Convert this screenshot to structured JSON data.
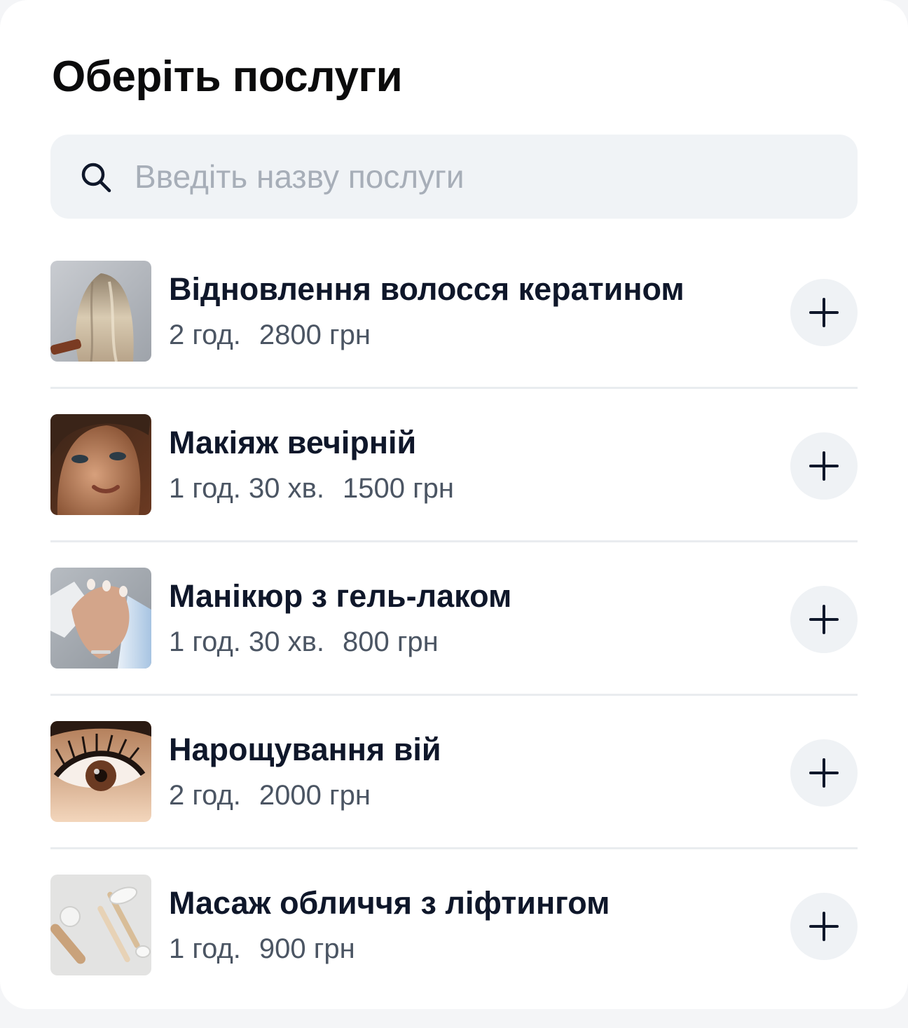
{
  "page": {
    "title": "Оберіть послуги"
  },
  "search": {
    "placeholder": "Введіть назву послуги",
    "icon": "search-icon"
  },
  "services": [
    {
      "name": "Відновлення волосся кератином",
      "duration": "2 год.",
      "price": "2800 грн",
      "image": "hair-photo"
    },
    {
      "name": "Макіяж вечірній",
      "duration": "1 год. 30 хв.",
      "price": "1500 грн",
      "image": "makeup-photo"
    },
    {
      "name": "Манікюр з гель-лаком",
      "duration": "1 год. 30 хв.",
      "price": "800 грн",
      "image": "manicure-photo"
    },
    {
      "name": "Нарощування вій",
      "duration": "2 год.",
      "price": "2000 грн",
      "image": "eyelash-photo"
    },
    {
      "name": "Масаж обличчя з ліфтингом",
      "duration": "1 год.",
      "price": "900 грн",
      "image": "face-massage-photo"
    }
  ],
  "add_button_icon": "plus-icon",
  "colors": {
    "title": "#0b0b0c",
    "service_name": "#0f172a",
    "meta_text": "#4b5563",
    "search_bg": "#f0f3f6",
    "placeholder": "#a7aeb8",
    "add_button_bg": "#eff2f5",
    "divider": "#e9ecef"
  }
}
